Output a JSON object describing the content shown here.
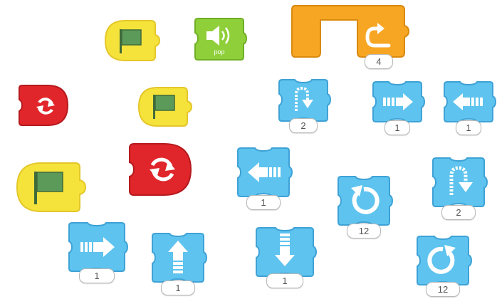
{
  "colors": {
    "trigger_yellow": "#f5e33b",
    "end_red": "#e0262b",
    "motion_blue": "#5ec3ee",
    "sound_green": "#8fcf3a",
    "control_orange": "#f7a623"
  },
  "palette": {
    "blocks": [
      {
        "kind": "trigger",
        "icon": "green-flag-icon"
      },
      {
        "kind": "sound",
        "icon": "speaker-icon",
        "label": "pop"
      },
      {
        "kind": "control",
        "icon": "repeat-icon",
        "value": "4"
      },
      {
        "kind": "end",
        "icon": "repeat-forever-icon"
      },
      {
        "kind": "trigger",
        "icon": "green-flag-icon"
      },
      {
        "kind": "motion",
        "icon": "hop-icon",
        "value": "2"
      },
      {
        "kind": "motion",
        "icon": "move-right-icon",
        "value": "1"
      },
      {
        "kind": "motion",
        "icon": "move-left-icon",
        "value": "1"
      },
      {
        "kind": "trigger",
        "icon": "green-flag-icon"
      },
      {
        "kind": "end",
        "icon": "repeat-forever-icon"
      },
      {
        "kind": "motion",
        "icon": "move-left-icon",
        "value": "1"
      },
      {
        "kind": "motion",
        "icon": "turn-left-icon",
        "value": "12"
      },
      {
        "kind": "motion",
        "icon": "hop-icon",
        "value": "2"
      },
      {
        "kind": "motion",
        "icon": "move-right-icon",
        "value": "1"
      },
      {
        "kind": "motion",
        "icon": "move-up-icon",
        "value": "1"
      },
      {
        "kind": "motion",
        "icon": "move-down-icon",
        "value": "1"
      },
      {
        "kind": "motion",
        "icon": "turn-right-icon",
        "value": "12"
      }
    ]
  }
}
